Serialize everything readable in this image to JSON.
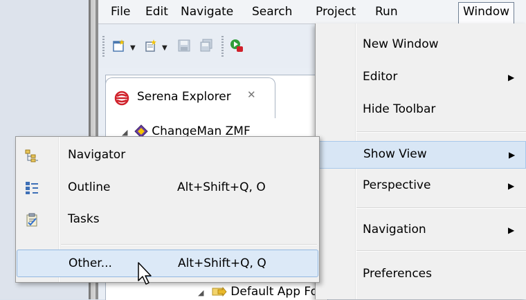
{
  "menubar": {
    "items": [
      "File",
      "Edit",
      "Navigate",
      "Search",
      "Project",
      "Run",
      "Window"
    ],
    "active": "Window"
  },
  "explorer": {
    "tab_label": "Serena Explorer",
    "tree": [
      "ChangeMan ZMF",
      "Default App Folder"
    ]
  },
  "window_menu": {
    "items": [
      {
        "label": "New Window",
        "submenu": false
      },
      {
        "label": "Editor",
        "submenu": true
      },
      {
        "label": "Hide Toolbar",
        "submenu": false
      },
      {
        "label": "Show View",
        "submenu": true
      },
      {
        "label": "Perspective",
        "submenu": true
      },
      {
        "label": "Navigation",
        "submenu": true
      },
      {
        "label": "Preferences",
        "submenu": false
      }
    ],
    "selected": "Show View"
  },
  "show_view_menu": {
    "items": [
      {
        "label": "Navigator",
        "shortcut": "",
        "icon": "navigator-icon"
      },
      {
        "label": "Outline",
        "shortcut": "Alt+Shift+Q, O",
        "icon": "outline-icon"
      },
      {
        "label": "Tasks",
        "shortcut": "",
        "icon": "tasks-icon"
      },
      {
        "label": "Other...",
        "shortcut": "Alt+Shift+Q, Q",
        "icon": ""
      }
    ],
    "selected": "Other..."
  },
  "colors": {
    "selection": "#dce9f7",
    "selection_border": "#92b7e0",
    "menu_bg": "#f0f0f0",
    "serena_red": "#d0202a"
  }
}
